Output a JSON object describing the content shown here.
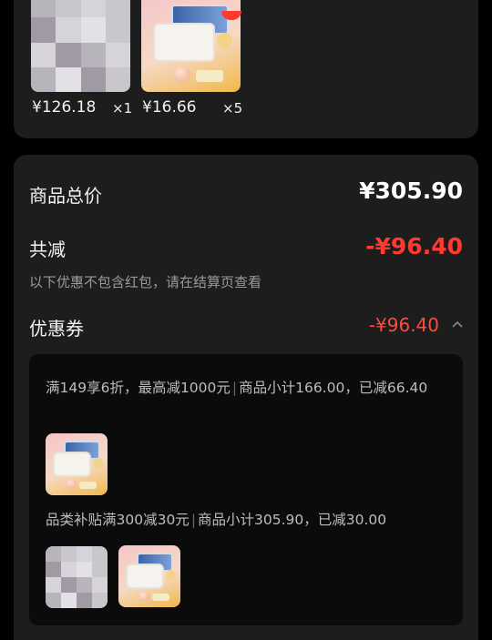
{
  "products": [
    {
      "price": "¥126.18",
      "qty": "×1",
      "image": "blurred-product"
    },
    {
      "price": "¥16.66",
      "qty": "×5",
      "image": "container-product"
    }
  ],
  "summary": {
    "total_label": "商品总价",
    "total_value": "¥305.90",
    "reduce_label": "共减",
    "reduce_value": "-¥96.40",
    "hint": "以下优惠不包含红包，请在结算页查看",
    "coupon_label": "优惠券",
    "coupon_value": "-¥96.40",
    "coupon_icon": "chevron-up-icon"
  },
  "coupon_details": [
    {
      "rule": "满149享6折，最高减1000元",
      "subtotal": "商品小计166.00，已减66.40"
    },
    {
      "rule": "品类补贴满300减30元",
      "subtotal": "商品小计305.90，已减30.00"
    }
  ],
  "colors": {
    "card": "#1d1d1d",
    "panel": "#0b0b0b",
    "discount_red": "#ff3b30",
    "text_primary": "#f2f2f2",
    "text_hint": "#9a9a9a"
  }
}
